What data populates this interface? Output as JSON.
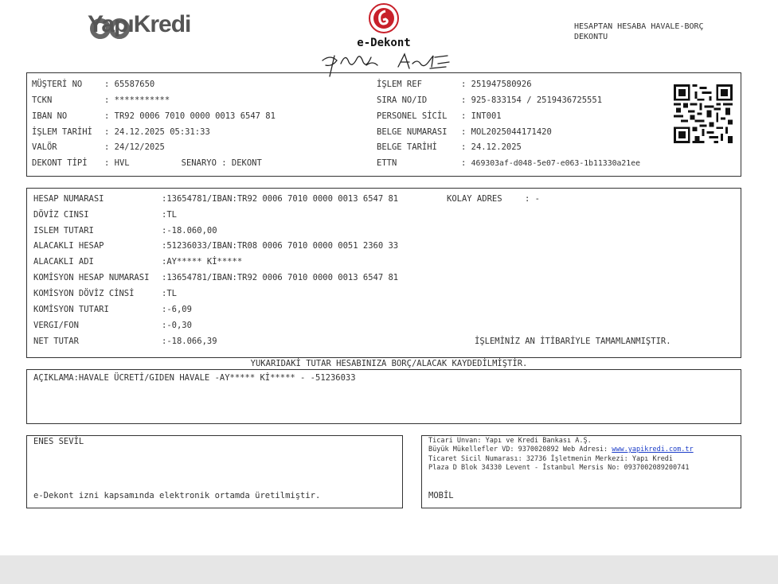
{
  "header": {
    "brand": "YapıKredi",
    "edekont_title": "e-Dekont",
    "doc_type_line1": "HESAPTAN HESABA HAVALE-BORÇ",
    "doc_type_line2": "DEKONTU"
  },
  "info": {
    "left": [
      {
        "label": "MÜŞTERİ NO",
        "value": "65587650"
      },
      {
        "label": "TCKN",
        "value": "***********"
      },
      {
        "label": "IBAN NO",
        "value": "TR92 0006 7010 0000 0013 6547 81"
      },
      {
        "label": "İŞLEM TARİHİ",
        "value": "24.12.2025 05:31:33"
      },
      {
        "label": "VALÖR",
        "value": "24/12/2025"
      },
      {
        "label": "DEKONT TİPİ",
        "value": "HVL"
      }
    ],
    "scenario_label": "SENARYO",
    "scenario_value": "DEKONT",
    "right": [
      {
        "label": "İŞLEM REF",
        "value": "251947580926"
      },
      {
        "label": "SIRA NO/ID",
        "value": "925-833154 / 2519436725551"
      },
      {
        "label": "PERSONEL SİCİL",
        "value": "INT001"
      },
      {
        "label": "BELGE NUMARASI",
        "value": "MOL2025044171420"
      },
      {
        "label": "BELGE TARİHİ",
        "value": "24.12.2025"
      },
      {
        "label": "ETTN",
        "value": "469303af-d048-5e07-e063-1b11330a21ee"
      }
    ]
  },
  "details": {
    "rows": [
      {
        "label": "HESAP NUMARASI",
        "value": "13654781/IBAN:TR92 0006 7010 0000 0013 6547 81"
      },
      {
        "label": "DÖVİZ CINSI",
        "value": "TL"
      },
      {
        "label": "ISLEM TUTARI",
        "value": "-18.060,00"
      },
      {
        "label": "ALACAKLI HESAP",
        "value": "51236033/IBAN:TR08 0006 7010 0000 0051 2360 33"
      },
      {
        "label": "ALACAKLI ADI",
        "value": "AY***** Kİ*****"
      },
      {
        "label": "KOMİSYON HESAP NUMARASI",
        "value": "13654781/IBAN:TR92 0006 7010 0000 0013 6547 81"
      },
      {
        "label": "KOMİSYON DÖVİZ CİNSİ",
        "value": "TL"
      },
      {
        "label": "KOMİSYON TUTARI",
        "value": "-6,09"
      },
      {
        "label": "VERGI/FON",
        "value": "-0,30"
      },
      {
        "label": "NET TUTAR",
        "value": "-18.066,39"
      }
    ],
    "kolay_adres_label": "KOLAY ADRES",
    "kolay_adres_value": "-",
    "status": "İŞLEMİNİZ AN İTİBARİYLE TAMAMLANMIŞTIR."
  },
  "notice": "YUKARIDAKİ TUTAR HESABINIZA BORÇ/ALACAK KAYDEDİLMİŞTİR.",
  "description": "AÇIKLAMA:HAVALE ÜCRETİ/GIDEN HAVALE -AY***** Kİ*****  - -51236033",
  "customer": {
    "name": "ENES SEVİL",
    "footer_note": "e-Dekont izni kapsamında elektronik ortamda üretilmiştir."
  },
  "bank": {
    "line1": "Ticari Unvan: Yapı ve Kredi Bankası A.Ş.",
    "line2_prefix": "Büyük Mükellefler VD: 9370020892 Web Adresi: ",
    "website": "www.yapikredi.com.tr",
    "line3": "Ticaret Sicil Numarası: 32736 İşletmenin Merkezi: Yapı Kredi",
    "line4": "Plaza D Blok 34330 Levent - İstanbul Mersis No: 0937002089200741",
    "channel": "MOBİL"
  },
  "colors": {
    "border": "#333333",
    "seal_red": "#c8202a",
    "link_blue": "#1a3cc8",
    "footer_band": "#e6e6e6"
  }
}
